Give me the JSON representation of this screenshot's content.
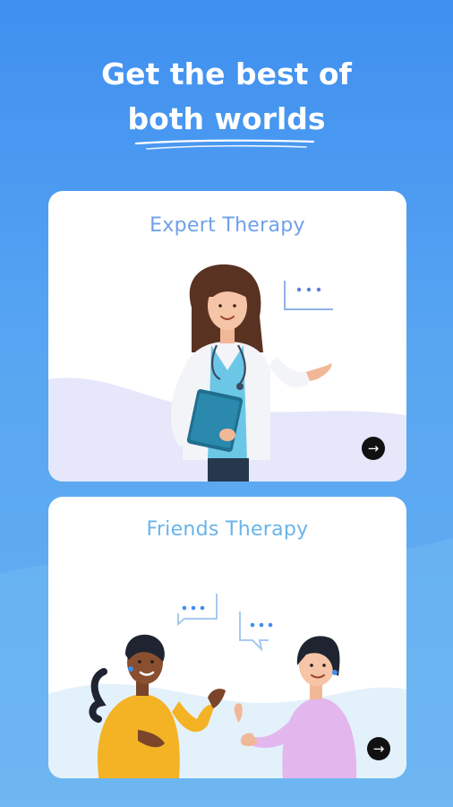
{
  "headline": {
    "line1": "Get the best of",
    "line2": "both worlds"
  },
  "cards": [
    {
      "title": "Expert Therapy",
      "arrow_icon": "arrow-right-icon"
    },
    {
      "title": "Friends Therapy",
      "arrow_icon": "arrow-right-icon"
    }
  ],
  "colors": {
    "background_top": "#3f8ff0",
    "background_bottom": "#6fb8f3",
    "card_bg": "#ffffff",
    "expert_title": "#6fa0e8",
    "friends_title": "#6ab4ea",
    "arrow_button": "#111111"
  }
}
